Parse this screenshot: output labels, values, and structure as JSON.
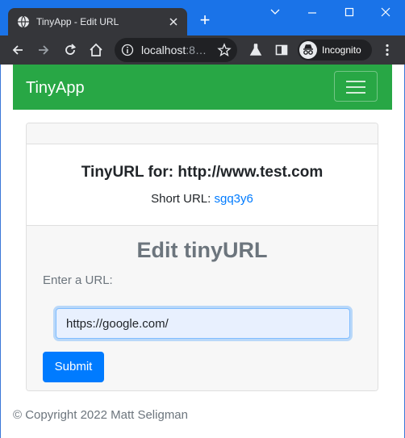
{
  "browser": {
    "tab_title": "TinyApp - Edit URL",
    "tab_icon": "globe-icon",
    "new_tab_label": "+",
    "address": {
      "host": "localhost",
      "rest": ":8…"
    },
    "incognito_label": "Incognito",
    "colors": {
      "titlebar": "#1a73e8",
      "toolbar": "#35363a"
    }
  },
  "navbar": {
    "brand": "TinyApp",
    "color": "#28a745"
  },
  "card": {
    "title": "TinyURL for: http://www.test.com",
    "short_url_label": "Short URL:",
    "short_url_value": "sgq3y6"
  },
  "edit": {
    "heading": "Edit tinyURL",
    "input_label": "Enter a URL:",
    "input_value": "https://google.com/",
    "submit_label": "Submit",
    "submit_color": "#007bff"
  },
  "footer": {
    "copyright": "© Copyright 2022 Matt Seligman"
  }
}
